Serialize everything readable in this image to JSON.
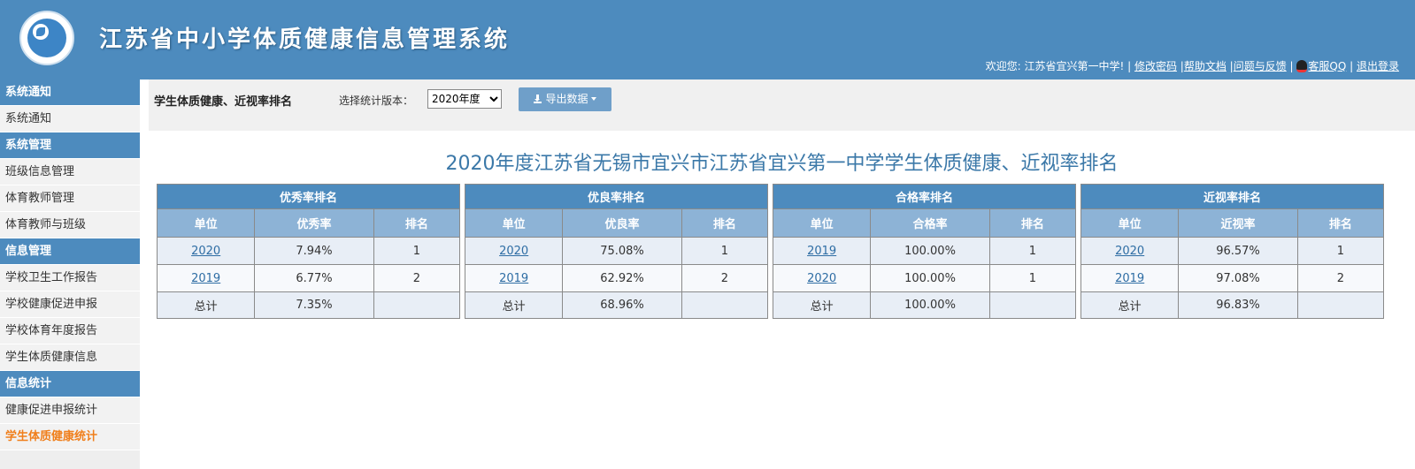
{
  "header": {
    "title": "江苏省中小学体质健康信息管理系统",
    "welcome": "欢迎您: 江苏省宜兴第一中学!",
    "links": [
      "修改密码",
      "帮助文档",
      "问题与反馈",
      "客服QQ",
      "退出登录"
    ]
  },
  "sidebar": [
    {
      "group": "系统通知",
      "items": [
        {
          "label": "系统通知"
        }
      ]
    },
    {
      "group": "系统管理",
      "items": [
        {
          "label": "班级信息管理"
        },
        {
          "label": "体育教师管理"
        },
        {
          "label": "体育教师与班级"
        }
      ]
    },
    {
      "group": "信息管理",
      "items": [
        {
          "label": "学校卫生工作报告"
        },
        {
          "label": "学校健康促进申报"
        },
        {
          "label": "学校体育年度报告"
        },
        {
          "label": "学生体质健康信息"
        }
      ]
    },
    {
      "group": "信息统计",
      "items": [
        {
          "label": "健康促进申报统计"
        },
        {
          "label": "学生体质健康统计",
          "active": true
        }
      ]
    }
  ],
  "toolbar": {
    "heading": "学生体质健康、近视率排名",
    "version_label": "选择统计版本：",
    "version_selected": "2020年度",
    "export_label": "导出数据"
  },
  "report": {
    "title": "2020年度江苏省无锡市宜兴市江苏省宜兴第一中学学生体质健康、近视率排名",
    "tables": [
      {
        "title": "优秀率排名",
        "headers": [
          "单位",
          "优秀率",
          "排名"
        ],
        "rows": [
          [
            "2020",
            "7.94%",
            "1"
          ],
          [
            "2019",
            "6.77%",
            "2"
          ]
        ],
        "total": [
          "总计",
          "7.35%",
          ""
        ]
      },
      {
        "title": "优良率排名",
        "headers": [
          "单位",
          "优良率",
          "排名"
        ],
        "rows": [
          [
            "2020",
            "75.08%",
            "1"
          ],
          [
            "2019",
            "62.92%",
            "2"
          ]
        ],
        "total": [
          "总计",
          "68.96%",
          ""
        ]
      },
      {
        "title": "合格率排名",
        "headers": [
          "单位",
          "合格率",
          "排名"
        ],
        "rows": [
          [
            "2019",
            "100.00%",
            "1"
          ],
          [
            "2020",
            "100.00%",
            "1"
          ]
        ],
        "total": [
          "总计",
          "100.00%",
          ""
        ]
      },
      {
        "title": "近视率排名",
        "headers": [
          "单位",
          "近视率",
          "排名"
        ],
        "rows": [
          [
            "2020",
            "96.57%",
            "1"
          ],
          [
            "2019",
            "97.08%",
            "2"
          ]
        ],
        "total": [
          "总计",
          "96.83%",
          ""
        ]
      }
    ]
  }
}
